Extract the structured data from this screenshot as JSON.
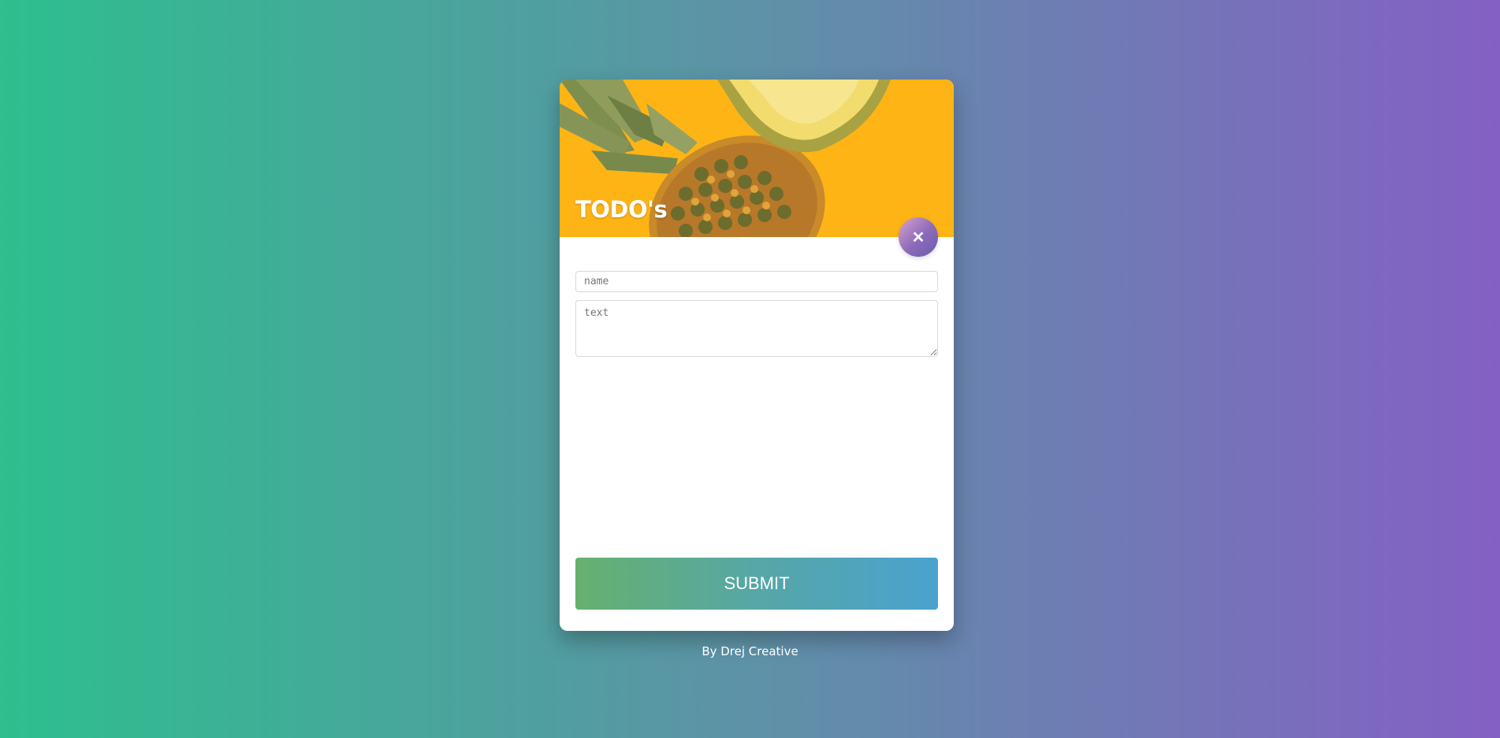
{
  "card": {
    "title": "TODO's",
    "close_icon": "close-icon",
    "close_glyph": "✕"
  },
  "form": {
    "name_placeholder": "name",
    "text_placeholder": "text",
    "name_value": "",
    "text_value": ""
  },
  "submit": {
    "label": "SUBMIT"
  },
  "footer": {
    "credit": "By Drej Creative"
  },
  "colors": {
    "background_start": "#2dbf8e",
    "background_end": "#8460c4",
    "header_image_bg": "#ffb415",
    "submit_start": "#66b06f",
    "submit_end": "#4aa2cf",
    "close_start": "#d8a1cf",
    "close_end": "#6c5bb0"
  }
}
